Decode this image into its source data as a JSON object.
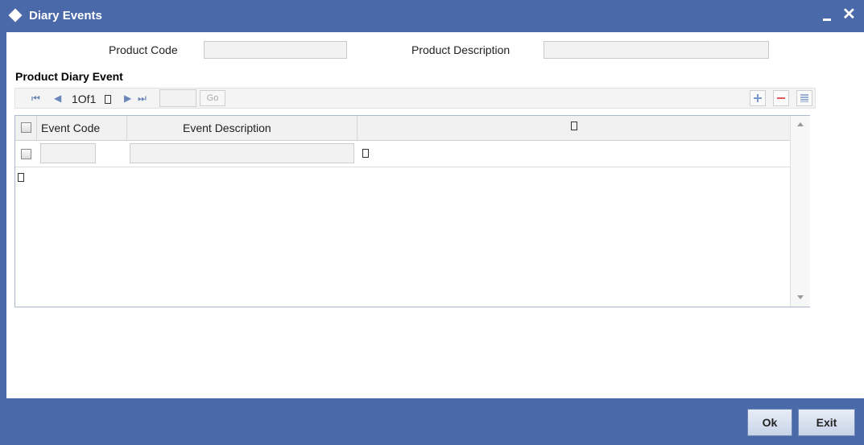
{
  "window": {
    "title": "Diary Events",
    "minimize_icon": "minimize-icon",
    "close_glyph": "✕"
  },
  "form": {
    "product_code_label": "Product Code",
    "product_code_value": "",
    "product_description_label": "Product Description",
    "product_description_value": ""
  },
  "section": {
    "title": "Product Diary Event"
  },
  "pager": {
    "first_glyph": "⏮",
    "prev_glyph": "◀",
    "page_text": "1Of1",
    "next_glyph": "▶",
    "last_glyph": "⏭",
    "page_input_value": "",
    "go_label": "Go",
    "add_icon": "plus-icon",
    "delete_icon": "minus-icon",
    "view_icon": "grid-view-icon"
  },
  "grid": {
    "columns": [
      "Event Code",
      "Event Description"
    ],
    "rows": [
      {
        "event_code": "",
        "event_description": ""
      }
    ]
  },
  "footer": {
    "ok_label": "Ok",
    "exit_label": "Exit"
  },
  "colors": {
    "titlebar": "#4a69a8",
    "footer": "#4a69a8"
  }
}
